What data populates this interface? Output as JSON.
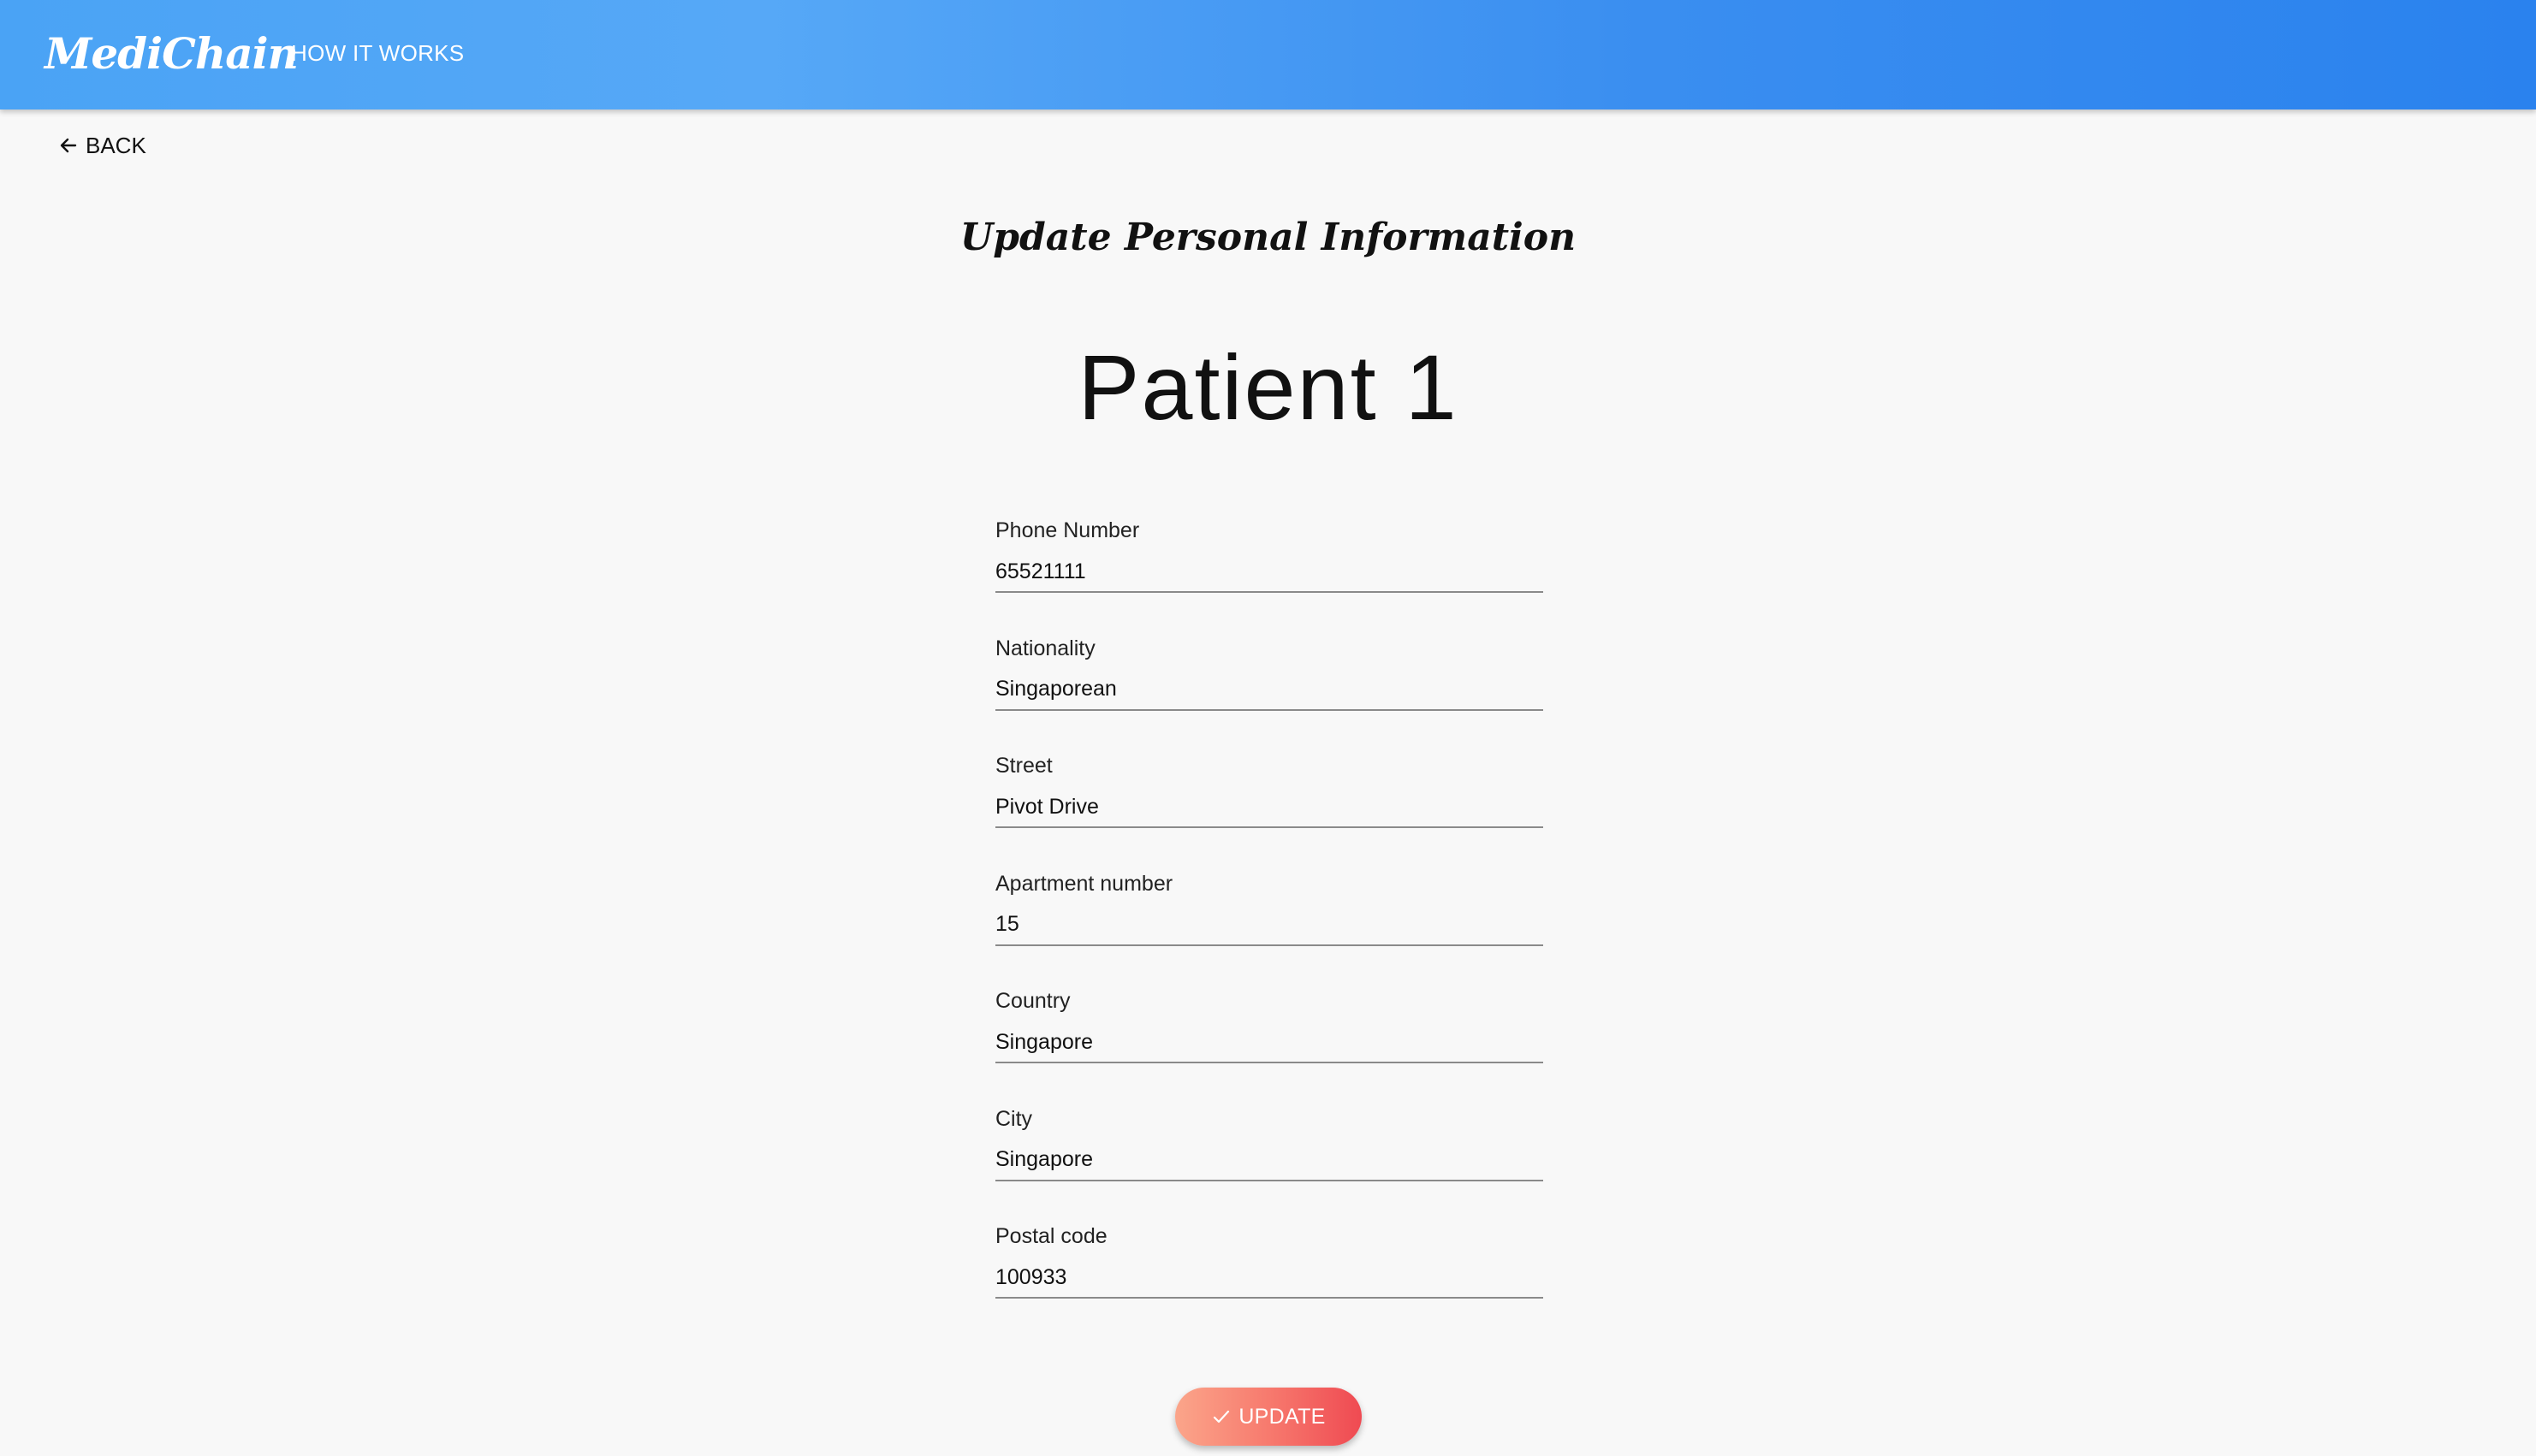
{
  "app_bar": {
    "brand": "MediChain",
    "nav_link": "HOW IT WORKS"
  },
  "back": {
    "label": "BACK",
    "icon": "arrow-left-icon"
  },
  "page": {
    "title": "Update Personal Information",
    "patient_name": "Patient 1"
  },
  "form": {
    "fields": [
      {
        "label": "Phone Number",
        "value": "65521111"
      },
      {
        "label": "Nationality",
        "value": "Singaporean"
      },
      {
        "label": "Street",
        "value": "Pivot Drive"
      },
      {
        "label": "Apartment number",
        "value": "15"
      },
      {
        "label": "Country",
        "value": "Singapore"
      },
      {
        "label": "City",
        "value": "Singapore"
      },
      {
        "label": "Postal code",
        "value": "100933"
      }
    ]
  },
  "update_button": {
    "label": "UPDATE",
    "icon": "check-icon"
  },
  "colors": {
    "app_bar_start": "#4aa3f5",
    "app_bar_end": "#2a82ee",
    "button_start": "#fba58a",
    "button_end": "#ef4a52",
    "background": "#f8f8f8"
  }
}
